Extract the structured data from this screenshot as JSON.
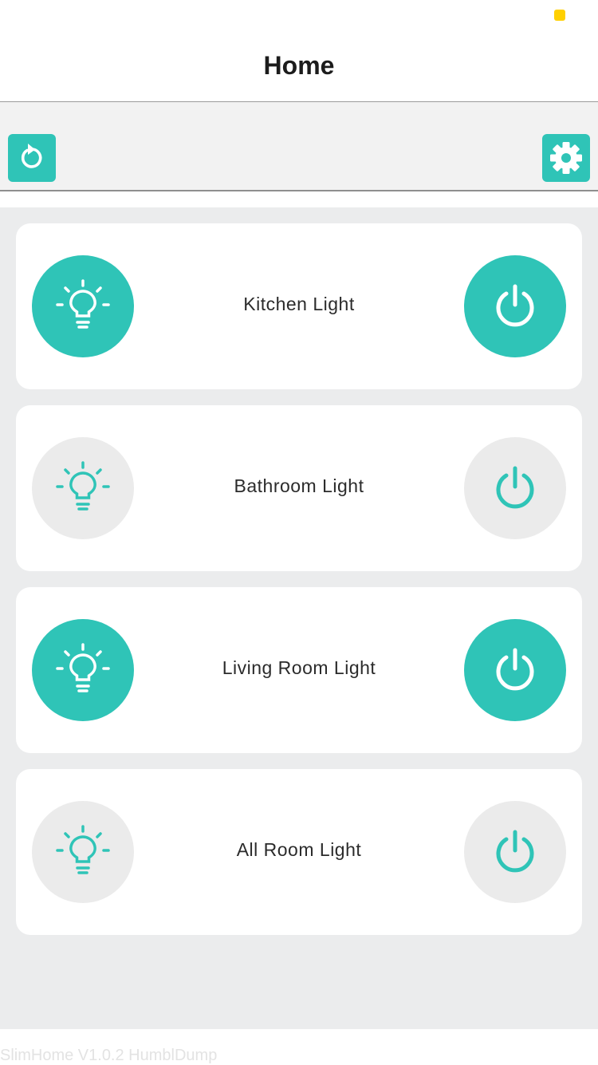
{
  "header": {
    "title": "Home"
  },
  "toolbar": {
    "left_icon": "refresh-icon",
    "right_icon": "gear-icon"
  },
  "colors": {
    "accent": "#2fc4b7",
    "off_background": "#ebebeb",
    "status_dot": "#ffd000"
  },
  "lights": [
    {
      "label": "Kitchen Light",
      "state": "on"
    },
    {
      "label": "Bathroom Light",
      "state": "off"
    },
    {
      "label": "Living Room Light",
      "state": "on"
    },
    {
      "label": "All Room Light",
      "state": "off"
    }
  ],
  "footer": {
    "text": "SlimHome V1.0.2 HumblDump"
  }
}
